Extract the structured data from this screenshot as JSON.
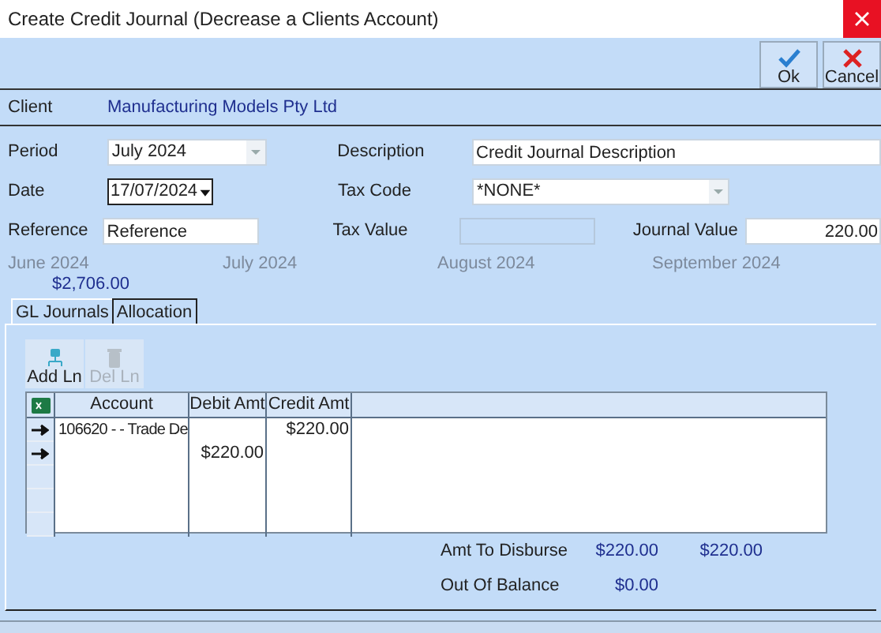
{
  "window": {
    "title": "Create Credit Journal (Decrease a Clients Account)"
  },
  "toolbar": [
    {
      "label": "Ok",
      "kind": "ok"
    },
    {
      "label": "Cancel",
      "kind": "cancel"
    }
  ],
  "client": {
    "label": "Client",
    "value": "Manufacturing Models Pty Ltd"
  },
  "form": {
    "period": {
      "label": "Period",
      "value": "July 2024"
    },
    "description": {
      "label": "Description",
      "value": "Credit Journal Description"
    },
    "date": {
      "label": "Date",
      "value": "17/07/2024"
    },
    "tax_code": {
      "label": "Tax Code",
      "value": "*NONE*"
    },
    "reference": {
      "label": "Reference",
      "value": "Reference"
    },
    "tax_value": {
      "label": "Tax Value",
      "disabled": true
    },
    "journal_value": {
      "label": "Journal Value",
      "value": "220.00"
    }
  },
  "months": [
    {
      "label": "June 2024",
      "amount": "$2,706.00"
    },
    {
      "label": "July 2024"
    },
    {
      "label": "August 2024"
    },
    {
      "label": "September 2024"
    }
  ],
  "tabs": [
    {
      "label": "GL Journals",
      "selected": true
    },
    {
      "label": "Allocation",
      "selected": false
    }
  ],
  "line_buttons": [
    {
      "label": "Add Ln",
      "disabled": false,
      "kind": "add"
    },
    {
      "label": "Del Ln",
      "disabled": true,
      "kind": "delete"
    }
  ],
  "table": {
    "columns": [
      "Account",
      "Debit Amt",
      "Credit Amt"
    ],
    "rows": [
      {
        "account": "106620 - - Trade De",
        "debit": "",
        "credit": "$220.00"
      },
      {
        "account": "",
        "debit": "$220.00",
        "credit": ""
      }
    ]
  },
  "totals": [
    {
      "label": "Amt To Disburse",
      "value_1": "$220.00",
      "value_2": "$220.00"
    },
    {
      "label": "Out Of Balance",
      "value_1": "$0.00"
    }
  ]
}
